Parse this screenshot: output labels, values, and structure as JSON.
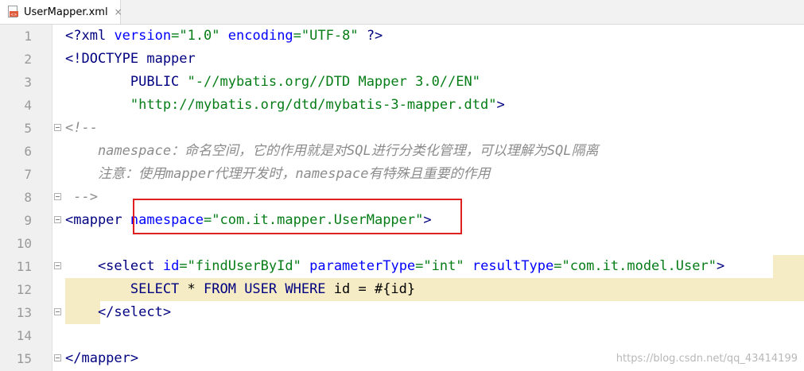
{
  "tab": {
    "filename": "UserMapper.xml",
    "close_glyph": "×",
    "icon": "xml-file-icon"
  },
  "lines": [
    {
      "n": "1"
    },
    {
      "n": "2"
    },
    {
      "n": "3"
    },
    {
      "n": "4"
    },
    {
      "n": "5"
    },
    {
      "n": "6"
    },
    {
      "n": "7"
    },
    {
      "n": "8"
    },
    {
      "n": "9"
    },
    {
      "n": "10"
    },
    {
      "n": "11"
    },
    {
      "n": "12"
    },
    {
      "n": "13"
    },
    {
      "n": "14"
    },
    {
      "n": "15"
    }
  ],
  "code": {
    "l1": {
      "a": "<?",
      "b": "xml ",
      "c": "version",
      "d": "=",
      "e": "\"1.0\"",
      "f": " ",
      "g": "encoding",
      "h": "=",
      "i": "\"UTF-8\"",
      "j": " ?>"
    },
    "l2": {
      "a": "<!DOCTYPE mapper"
    },
    "l3": {
      "a": "        PUBLIC ",
      "b": "\"-//mybatis.org//DTD Mapper 3.0//EN\""
    },
    "l4": {
      "a": "        ",
      "b": "\"http://mybatis.org/dtd/mybatis-3-mapper.dtd\"",
      "c": ">"
    },
    "l5": {
      "a": "<!--"
    },
    "l6": {
      "a": "    namespace：命名空间，它的作用就是对SQL进行分类化管理，可以理解为SQL隔离"
    },
    "l7": {
      "a": "    注意：使用mapper代理开发时，namespace有特殊且重要的作用"
    },
    "l8": {
      "a": " -->"
    },
    "l9": {
      "a": "<mapper ",
      "b": "namespace",
      "c": "=",
      "d": "\"com.it.mapper.UserMapper\"",
      "e": ">"
    },
    "l11": {
      "a": "    <select ",
      "b": "id",
      "c": "=",
      "d": "\"findUserById\"",
      "e": " ",
      "f": "parameterType",
      "g": "=",
      "h": "\"int\"",
      "i": " ",
      "j": "resultType",
      "k": "=",
      "l": "\"com.it.model.User\"",
      "m": ">"
    },
    "l12": {
      "a": "        SELECT ",
      "b": "* ",
      "c": "FROM USER WHERE ",
      "d": "id = #{id}"
    },
    "l13": {
      "a": "    </select>"
    },
    "l15": {
      "a": "</mapper>"
    }
  },
  "watermark": "https://blog.csdn.net/qq_43414199",
  "colors": {
    "highlight": "#f5ecc5",
    "annotation_box": "#e02020",
    "tag": "#000080",
    "attr": "#0000ff",
    "value": "#067d17",
    "comment": "#8c8c8c"
  }
}
